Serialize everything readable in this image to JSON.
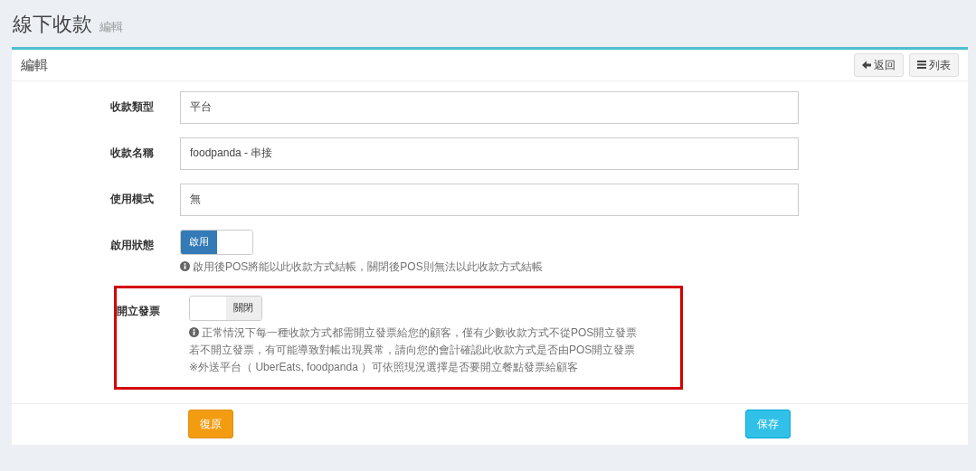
{
  "page": {
    "title": "線下收款",
    "subtitle": "編輯"
  },
  "card": {
    "title": "編輯",
    "buttons": [
      {
        "kind": "back",
        "label": "返回"
      },
      {
        "kind": "list",
        "label": "列表"
      }
    ]
  },
  "fields": [
    {
      "kind": "text",
      "label": "收款類型",
      "value": "平台"
    },
    {
      "kind": "text",
      "label": "收款名稱",
      "value": "foodpanda - 串接"
    },
    {
      "kind": "text",
      "label": "使用模式",
      "value": "無"
    },
    {
      "kind": "toggle",
      "label": "啟用狀態",
      "on": true,
      "toggle_label": "啟用",
      "highlighted": false,
      "help": [
        "啟用後POS將能以此收款方式結帳，關閉後POS則無法以此收款方式結帳"
      ]
    },
    {
      "kind": "toggle",
      "label": "開立發票",
      "on": false,
      "toggle_label": "關閉",
      "highlighted": true,
      "help": [
        "正常情況下每一種收款方式都需開立發票給您的顧客，僅有少數收款方式不從POS開立發票",
        "若不開立發票，有可能導致對帳出現異常，請向您的會計確認此收款方式是否由POS開立發票",
        "※外送平台（ UberEats, foodpanda ）可依照現況選擇是否要開立餐點發票給顧客"
      ]
    }
  ],
  "footer": {
    "reset": "復原",
    "save": "保存"
  }
}
